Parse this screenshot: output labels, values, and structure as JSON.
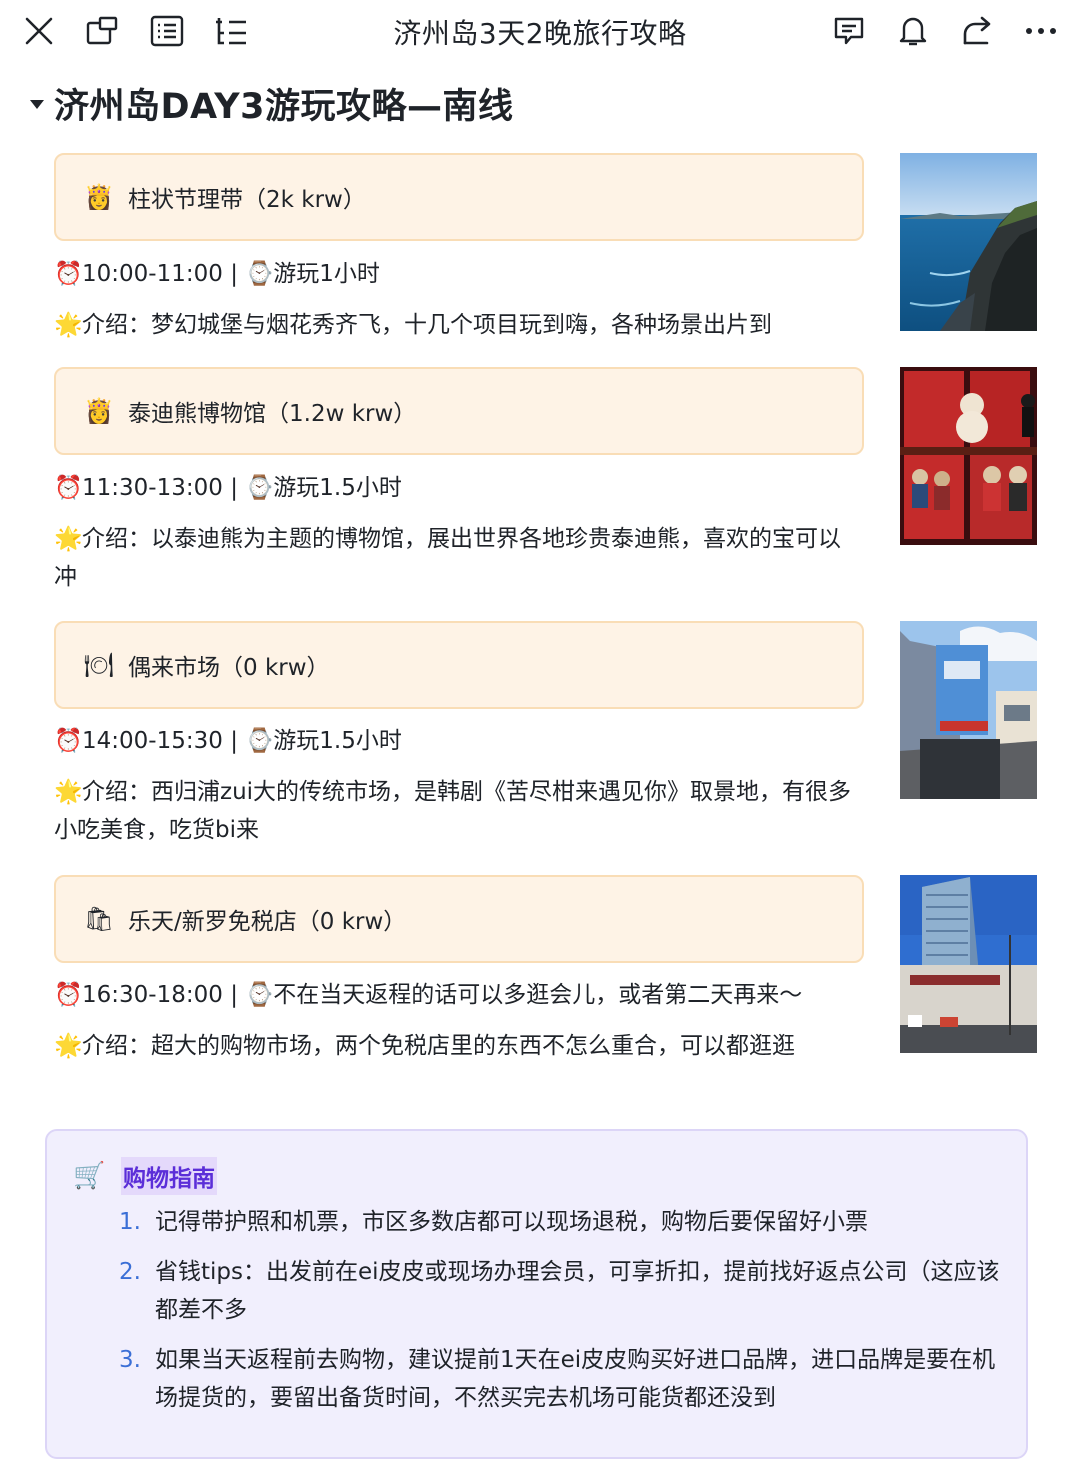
{
  "topbar": {
    "title": "济州岛3天2晚旅行攻略",
    "icons_left": [
      "close-icon",
      "window-icon",
      "outline-icon",
      "list-tree-icon"
    ],
    "icons_right": [
      "comment-icon",
      "bell-icon",
      "share-icon",
      "more-icon"
    ]
  },
  "section": {
    "heading": "济州岛DAY3游玩攻略—南线"
  },
  "spots": [
    {
      "emoji": "👸",
      "title": "柱状节理带（2k krw）",
      "time_icon": "⏰",
      "time": "10:00-11:00",
      "sep": "|",
      "watch_icon": "⌚",
      "duration": "游玩1小时",
      "intro_icon": "🌟",
      "intro": "介绍：梦幻城堡与烟花秀齐飞，十几个项目玩到嗨，各种场景出片到",
      "photo": "coastal-cliffs-photo"
    },
    {
      "emoji": "👸",
      "title": "泰迪熊博物馆（1.2w krw）",
      "time_icon": "⏰",
      "time": "11:30-13:00",
      "sep": "|",
      "watch_icon": "⌚",
      "duration": "游玩1.5小时",
      "intro_icon": "🌟",
      "intro": "介绍：以泰迪熊为主题的博物馆，展出世界各地珍贵泰迪熊，喜欢的宝可以冲",
      "photo": "teddy-bear-display-photo"
    },
    {
      "emoji": "🍽",
      "title": "偶来市场（0 krw）",
      "time_icon": "⏰",
      "time": "14:00-15:30",
      "sep": "|",
      "watch_icon": "⌚",
      "duration": "游玩1.5小时",
      "intro_icon": "🌟",
      "intro": "介绍：西归浦zui大的传统市场，是韩剧《苦尽柑来遇见你》取景地，有很多小吃美食，吃货bi来",
      "photo": "market-gate-photo"
    },
    {
      "emoji": "🛍",
      "title": "乐天/新罗免税店（0 krw）",
      "time_icon": "⏰",
      "time": "16:30-18:00",
      "sep": "|",
      "watch_icon": "⌚",
      "duration": "不在当天返程的话可以多逛会儿，或者第二天再来～",
      "intro_icon": "🌟",
      "intro": "介绍：超大的购物市场，两个免税店里的东西不怎么重合，可以都逛逛",
      "photo": "duty-free-building-photo"
    }
  ],
  "guide": {
    "icon": "🛒",
    "title": "购物指南",
    "items": [
      {
        "num": "1.",
        "text": "记得带护照和机票，市区多数店都可以现场退税，购物后要保留好小票"
      },
      {
        "num": "2.",
        "text": "省钱tips：出发前在ei皮皮或现场办理会员，可享折扣，提前找好返点公司（这应该都差不多"
      },
      {
        "num": "3.",
        "text": "如果当天返程前去购物，建议提前1天在ei皮皮购买好进口品牌，进口品牌是要在机场提货的，要留出备货时间，不然买完去机场可能货都还没到"
      }
    ]
  }
}
